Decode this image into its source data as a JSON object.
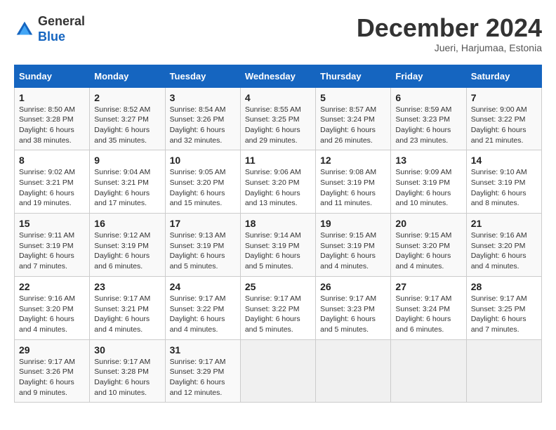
{
  "header": {
    "logo_general": "General",
    "logo_blue": "Blue",
    "month_title": "December 2024",
    "subtitle": "Jueri, Harjumaa, Estonia"
  },
  "weekdays": [
    "Sunday",
    "Monday",
    "Tuesday",
    "Wednesday",
    "Thursday",
    "Friday",
    "Saturday"
  ],
  "weeks": [
    [
      {
        "day": "1",
        "info": "Sunrise: 8:50 AM\nSunset: 3:28 PM\nDaylight: 6 hours\nand 38 minutes."
      },
      {
        "day": "2",
        "info": "Sunrise: 8:52 AM\nSunset: 3:27 PM\nDaylight: 6 hours\nand 35 minutes."
      },
      {
        "day": "3",
        "info": "Sunrise: 8:54 AM\nSunset: 3:26 PM\nDaylight: 6 hours\nand 32 minutes."
      },
      {
        "day": "4",
        "info": "Sunrise: 8:55 AM\nSunset: 3:25 PM\nDaylight: 6 hours\nand 29 minutes."
      },
      {
        "day": "5",
        "info": "Sunrise: 8:57 AM\nSunset: 3:24 PM\nDaylight: 6 hours\nand 26 minutes."
      },
      {
        "day": "6",
        "info": "Sunrise: 8:59 AM\nSunset: 3:23 PM\nDaylight: 6 hours\nand 23 minutes."
      },
      {
        "day": "7",
        "info": "Sunrise: 9:00 AM\nSunset: 3:22 PM\nDaylight: 6 hours\nand 21 minutes."
      }
    ],
    [
      {
        "day": "8",
        "info": "Sunrise: 9:02 AM\nSunset: 3:21 PM\nDaylight: 6 hours\nand 19 minutes."
      },
      {
        "day": "9",
        "info": "Sunrise: 9:04 AM\nSunset: 3:21 PM\nDaylight: 6 hours\nand 17 minutes."
      },
      {
        "day": "10",
        "info": "Sunrise: 9:05 AM\nSunset: 3:20 PM\nDaylight: 6 hours\nand 15 minutes."
      },
      {
        "day": "11",
        "info": "Sunrise: 9:06 AM\nSunset: 3:20 PM\nDaylight: 6 hours\nand 13 minutes."
      },
      {
        "day": "12",
        "info": "Sunrise: 9:08 AM\nSunset: 3:19 PM\nDaylight: 6 hours\nand 11 minutes."
      },
      {
        "day": "13",
        "info": "Sunrise: 9:09 AM\nSunset: 3:19 PM\nDaylight: 6 hours\nand 10 minutes."
      },
      {
        "day": "14",
        "info": "Sunrise: 9:10 AM\nSunset: 3:19 PM\nDaylight: 6 hours\nand 8 minutes."
      }
    ],
    [
      {
        "day": "15",
        "info": "Sunrise: 9:11 AM\nSunset: 3:19 PM\nDaylight: 6 hours\nand 7 minutes."
      },
      {
        "day": "16",
        "info": "Sunrise: 9:12 AM\nSunset: 3:19 PM\nDaylight: 6 hours\nand 6 minutes."
      },
      {
        "day": "17",
        "info": "Sunrise: 9:13 AM\nSunset: 3:19 PM\nDaylight: 6 hours\nand 5 minutes."
      },
      {
        "day": "18",
        "info": "Sunrise: 9:14 AM\nSunset: 3:19 PM\nDaylight: 6 hours\nand 5 minutes."
      },
      {
        "day": "19",
        "info": "Sunrise: 9:15 AM\nSunset: 3:19 PM\nDaylight: 6 hours\nand 4 minutes."
      },
      {
        "day": "20",
        "info": "Sunrise: 9:15 AM\nSunset: 3:20 PM\nDaylight: 6 hours\nand 4 minutes."
      },
      {
        "day": "21",
        "info": "Sunrise: 9:16 AM\nSunset: 3:20 PM\nDaylight: 6 hours\nand 4 minutes."
      }
    ],
    [
      {
        "day": "22",
        "info": "Sunrise: 9:16 AM\nSunset: 3:20 PM\nDaylight: 6 hours\nand 4 minutes."
      },
      {
        "day": "23",
        "info": "Sunrise: 9:17 AM\nSunset: 3:21 PM\nDaylight: 6 hours\nand 4 minutes."
      },
      {
        "day": "24",
        "info": "Sunrise: 9:17 AM\nSunset: 3:22 PM\nDaylight: 6 hours\nand 4 minutes."
      },
      {
        "day": "25",
        "info": "Sunrise: 9:17 AM\nSunset: 3:22 PM\nDaylight: 6 hours\nand 5 minutes."
      },
      {
        "day": "26",
        "info": "Sunrise: 9:17 AM\nSunset: 3:23 PM\nDaylight: 6 hours\nand 5 minutes."
      },
      {
        "day": "27",
        "info": "Sunrise: 9:17 AM\nSunset: 3:24 PM\nDaylight: 6 hours\nand 6 minutes."
      },
      {
        "day": "28",
        "info": "Sunrise: 9:17 AM\nSunset: 3:25 PM\nDaylight: 6 hours\nand 7 minutes."
      }
    ],
    [
      {
        "day": "29",
        "info": "Sunrise: 9:17 AM\nSunset: 3:26 PM\nDaylight: 6 hours\nand 9 minutes."
      },
      {
        "day": "30",
        "info": "Sunrise: 9:17 AM\nSunset: 3:28 PM\nDaylight: 6 hours\nand 10 minutes."
      },
      {
        "day": "31",
        "info": "Sunrise: 9:17 AM\nSunset: 3:29 PM\nDaylight: 6 hours\nand 12 minutes."
      },
      {
        "day": "",
        "info": ""
      },
      {
        "day": "",
        "info": ""
      },
      {
        "day": "",
        "info": ""
      },
      {
        "day": "",
        "info": ""
      }
    ]
  ]
}
